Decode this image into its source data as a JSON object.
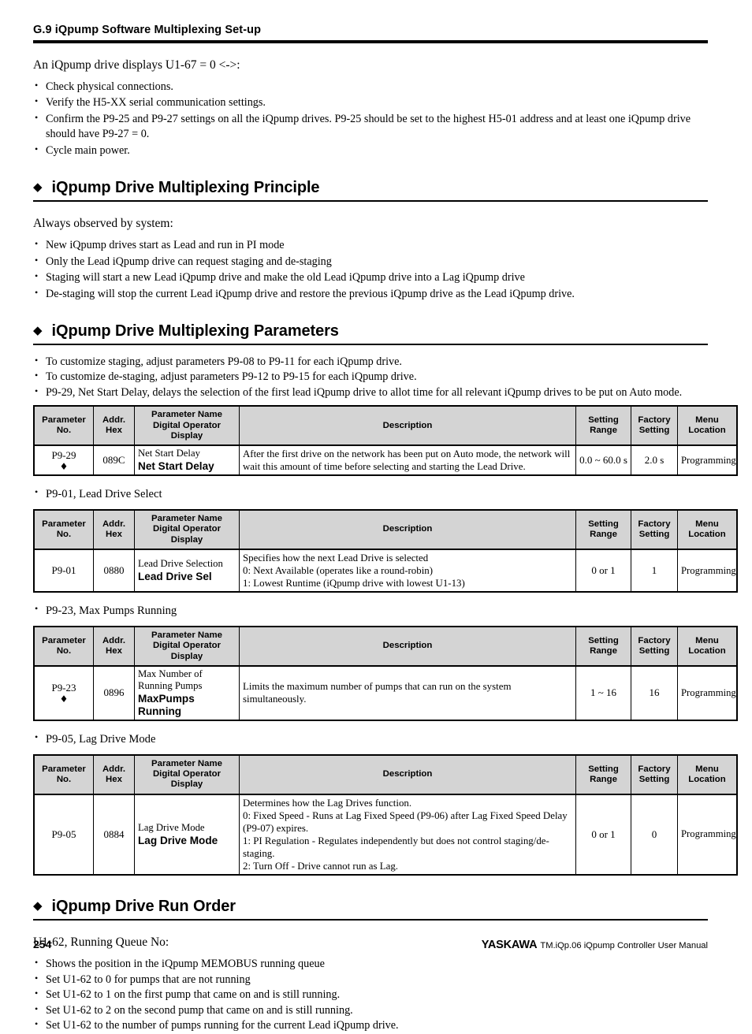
{
  "running_header": {
    "title": "G.9  iQpump Software Multiplexing Set-up"
  },
  "intro": {
    "lead": "An iQpump drive displays U1-67 = 0 <->:",
    "bullets": [
      "Check physical connections.",
      "Verify the H5-XX serial communication settings.",
      "Confirm the P9-25 and P9-27 settings on all the iQpump drives. P9-25 should be set to the highest H5-01 address and at least one iQpump drive should have P9-27 = 0.",
      "Cycle main power."
    ]
  },
  "sections": [
    {
      "diamond": "◆",
      "title": "iQpump Drive Multiplexing Principle",
      "lead": "Always observed by system:",
      "bullets": [
        "New iQpump drives start as Lead and run in PI mode",
        "Only the Lead iQpump drive can request staging and de-staging",
        "Staging will start a new Lead iQpump drive and make the old Lead iQpump drive into a Lag iQpump drive",
        "De-staging will stop the current Lead iQpump drive and restore the previous iQpump drive as the Lead iQpump drive."
      ]
    },
    {
      "diamond": "◆",
      "title": "iQpump Drive Multiplexing Parameters",
      "bullets": [
        "To customize staging, adjust parameters P9-08 to P9-11 for each iQpump drive.",
        "To customize de-staging, adjust parameters P9-12 to P9-15 for each iQpump drive.",
        "P9-29, Net Start Delay, delays the selection of the first lead iQpump drive to allot time for all relevant iQpump drives to be put on Auto mode."
      ]
    },
    {
      "diamond": "◆",
      "title": "iQpump Drive Run Order",
      "lead": "U1-62, Running Queue No:",
      "bullets": [
        "Shows the position in the iQpump MEMOBUS running queue",
        "Set U1-62 to 0 for pumps that are not running",
        "Set U1-62 to 1 on the first pump that came on and is still running.",
        "Set U1-62 to 2 on the second pump that came on and is still running.",
        "Set U1-62 to the number of pumps running for the current Lead iQpump drive."
      ]
    }
  ],
  "table_headers": {
    "parameter_no": "Parameter\nNo.",
    "parameter_no_l1": "Parameter",
    "parameter_no_l2": "No.",
    "addr_l1": "Addr.",
    "addr_l2": "Hex",
    "pname_l1": "Parameter Name",
    "pname_l2": "Digital Operator",
    "pname_l3": "Display",
    "description": "Description",
    "range_l1": "Setting",
    "range_l2": "Range",
    "factory_l1": "Factory",
    "factory_l2": "Setting",
    "menu_l1": "Menu",
    "menu_l2": "Location"
  },
  "tables": [
    {
      "caption": null,
      "param_no": "P9-29",
      "has_diamond": true,
      "diamond": "♦",
      "addr_hex": "089C",
      "name_plain": "Net Start Delay",
      "name_digital": "Net Start Delay",
      "name_plain_2": "",
      "desc_lines": [
        "After the first drive on the network has been put on Auto mode, the network will",
        "wait this amount of time before selecting and starting the Lead Drive."
      ],
      "setting_range": "0.0 ~ 60.0 s",
      "factory_setting": "2.0 s",
      "menu_location": "Programming"
    },
    {
      "caption": "P9-01, Lead Drive Select",
      "param_no": "P9-01",
      "has_diamond": false,
      "diamond": "",
      "addr_hex": "0880",
      "name_plain": "Lead Drive Selection",
      "name_digital": "Lead Drive Sel",
      "name_plain_2": "",
      "desc_lines": [
        "Specifies how the next Lead Drive is selected",
        "0: Next Available (operates like a round-robin)",
        "1: Lowest Runtime (iQpump drive with lowest U1-13)"
      ],
      "setting_range": "0 or 1",
      "factory_setting": "1",
      "menu_location": "Programming"
    },
    {
      "caption": "P9-23, Max Pumps Running",
      "param_no": "P9-23",
      "has_diamond": true,
      "diamond": "♦",
      "addr_hex": "0896",
      "name_plain": "Max Number of",
      "name_plain_2": "Running Pumps",
      "name_digital": "MaxPumps Running",
      "desc_lines": [
        "Limits the maximum number of pumps that can run on the system simultaneously."
      ],
      "setting_range": "1 ~ 16",
      "factory_setting": "16",
      "menu_location": "Programming"
    },
    {
      "caption": "P9-05, Lag Drive Mode",
      "param_no": "P9-05",
      "has_diamond": false,
      "diamond": "",
      "addr_hex": "0884",
      "name_plain": "Lag Drive Mode",
      "name_plain_2": "",
      "name_digital": "Lag Drive Mode",
      "desc_lines": [
        "Determines how the Lag Drives function.",
        "0: Fixed Speed - Runs at Lag Fixed Speed (P9-06) after Lag Fixed Speed Delay",
        "(P9-07) expires.",
        "1: PI Regulation - Regulates independently but does not control staging/de-staging.",
        "2: Turn Off - Drive cannot run as Lag."
      ],
      "setting_range": "0 or 1",
      "factory_setting": "0",
      "menu_location": "Programming"
    }
  ],
  "footer": {
    "page_number": "254",
    "brand": "YASKAWA",
    "manual": "TM.iQp.06 iQpump Controller User Manual"
  }
}
